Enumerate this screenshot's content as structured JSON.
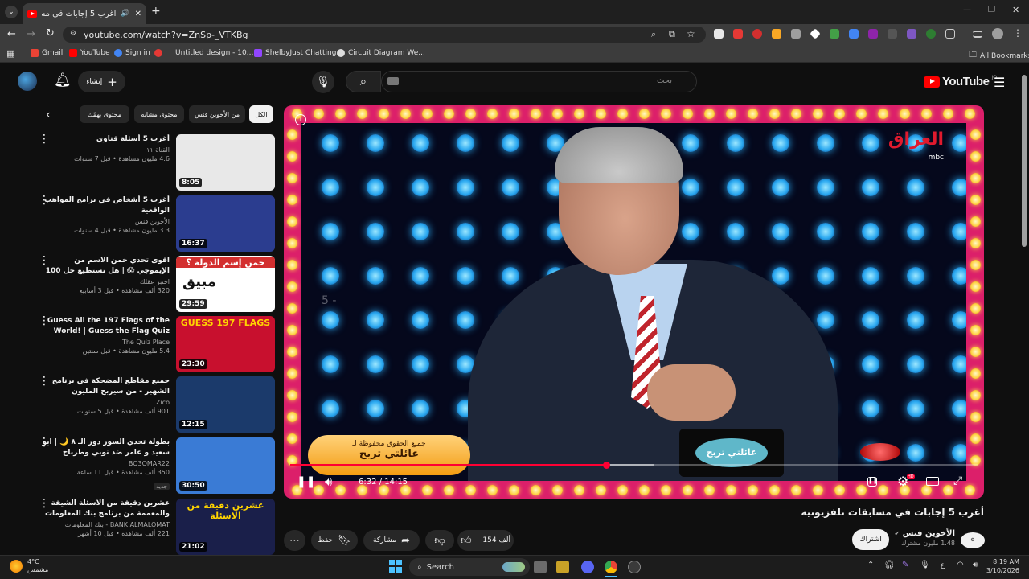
{
  "browser": {
    "tab_title": "أغرب 5 إجابات في مسابقات تل",
    "new_tab": "+",
    "url": "youtube.com/watch?v=ZnSp-_VTKBg",
    "window_controls": {
      "minimize": "—",
      "maximize": "❐",
      "close": "✕"
    },
    "bookmarks": [
      {
        "label": "Gmail",
        "color": "#ea4335"
      },
      {
        "label": "YouTube",
        "color": "#ff0000"
      },
      {
        "label": "Sign in",
        "color": "#4285f4"
      },
      {
        "label": "Untitled design - 10...",
        "color": "#00c4cc"
      },
      {
        "label": "ShelbyJust Chatting...",
        "color": "#9146ff"
      },
      {
        "label": "Circuit Diagram We...",
        "color": "#e0e0e0"
      }
    ],
    "all_bookmarks": "All Bookmarks"
  },
  "header": {
    "logo_text": "YouTube",
    "logo_superscript": "JO",
    "search_placeholder": "بحث",
    "create_label": "إنشاء"
  },
  "chips": [
    "الكل",
    "من الأخوين فنس",
    "محتوى مشابه",
    "محتوى يهمّك"
  ],
  "recommendations": [
    {
      "title": "أغرب 5 أسئلة قناوي",
      "channel": "القناة ١١",
      "stats": "4.6 مليون مشاهدة • قبل 7 سنوات",
      "duration": "8:05",
      "thumb_bg": "#e8e8e8",
      "english": false
    },
    {
      "title": "أغرب 5 أشخاص في برامج المواهب الواقعية",
      "channel": "الأخوين فنس",
      "stats": "3.3 مليون مشاهدة • قبل 4 سنوات",
      "duration": "16:37",
      "thumb_bg": "#2b3d8f",
      "english": false
    },
    {
      "title": "اقوى تحدي خمن الاسم من الإيموجي 😱 | هل تستطيع حل 100 لغز قبل انتهاء الوقت ...",
      "channel": "اختبر عقلك",
      "stats": "320 ألف مشاهدة • قبل 3 أسابيع",
      "duration": "29:59",
      "thumb_bg": "#ffffff",
      "thumb_text": "خمن إسم الدولة ؟",
      "thumb_sub": "مبيق",
      "english": false
    },
    {
      "title": "Guess All the 197 Flags of the World! | Guess the Flag Quiz",
      "channel": "The Quiz Place",
      "stats": "5.4 مليون مشاهدة • قبل سنتين",
      "duration": "23:30",
      "thumb_bg": "#c8102e",
      "thumb_text": "GUESS 197 FLAGS",
      "english": true
    },
    {
      "title": "جميع مقاطع المضحكة في برنامج الشهير - من سيربح المليون",
      "channel": "Zico",
      "stats": "901 ألف مشاهدة • قبل 5 سنوات",
      "duration": "12:15",
      "thumb_bg": "#1b3a6b",
      "english": false
    },
    {
      "title": "بطولة تحدي السور دور الـ ٨ 🌙 | ابو سعيد و عامر ضد نوبي وطرباخ",
      "channel": "BO3OMAR22",
      "stats": "350 ألف مشاهدة • قبل 11 ساعة",
      "badge": "جديد",
      "duration": "30:50",
      "thumb_bg": "#3a7bd5",
      "english": false
    },
    {
      "title": "عشرين دقيقة من الاسئلة الشيقة والمعممة من برنامج بنك المعلومات 💡",
      "channel": "BANK ALMALOMAT - بنك المعلومات",
      "stats": "221 ألف مشاهدة • قبل 10 أشهر",
      "duration": "21:02",
      "thumb_bg": "#1a1f4a",
      "thumb_text": "عشرين دقيقة من الاسئلة",
      "english": false
    }
  ],
  "player": {
    "time_current": "6:32",
    "time_separator": "/",
    "time_total": "14:15",
    "progress": 0.46,
    "loaded": 0.53,
    "skip_hint": "5 -",
    "logo_overlay": "العراق",
    "logo_overlay_sub": "mbc",
    "lower_third_line1": "جميع الحقوق محفوظة لـ",
    "lower_third_line2": "عائلتي تربح",
    "podium_text": "عائلتي تربح",
    "info_icon": "i",
    "hd_badge": "HD"
  },
  "video": {
    "title": "أغرب 5 إجابات في مسابقات تلفزيونية",
    "channel": "الأخوين فنس",
    "subscribers": "1.48 مليون مشترك",
    "subscribe_label": "اشتراك",
    "likes": "154 ألف",
    "share_label": "مشاركة",
    "save_label": "حفظ"
  },
  "taskbar": {
    "weather_temp": "4°C",
    "weather_desc": "مشمس",
    "search_label": "Search",
    "time": "8:19 AM",
    "date": "3/10/2026",
    "lang": "ع"
  }
}
